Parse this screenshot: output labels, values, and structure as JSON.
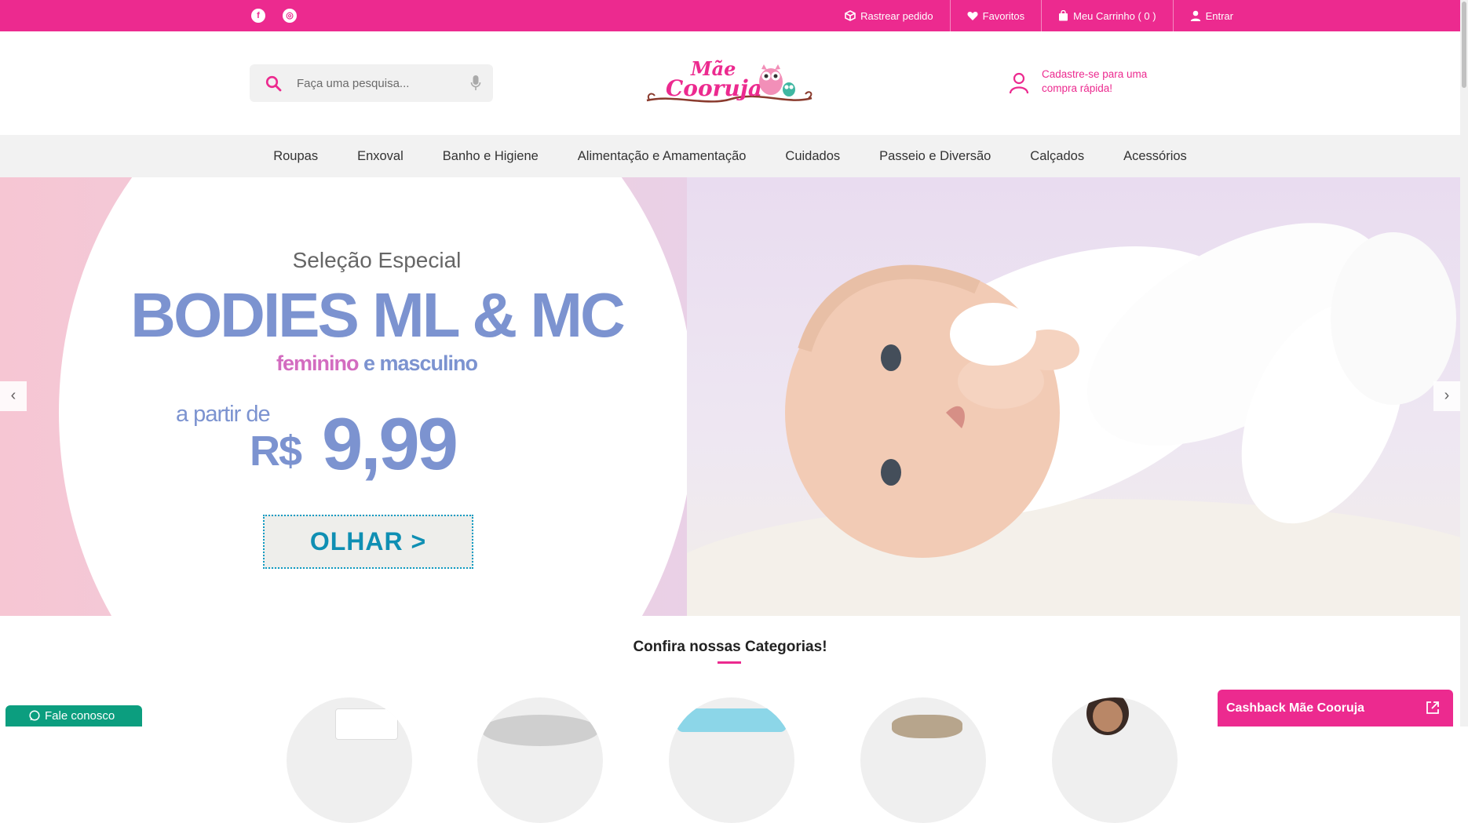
{
  "topbar": {
    "social": [
      {
        "icon": "facebook-icon",
        "glyph": "f"
      },
      {
        "icon": "instagram-icon",
        "glyph": "◎"
      }
    ],
    "links": [
      {
        "label": "Rastrear pedido",
        "icon": "package-icon"
      },
      {
        "label": "Favoritos",
        "icon": "heart-icon"
      },
      {
        "label": "Meu Carrinho ( 0 )",
        "icon": "shopping-bag-icon"
      },
      {
        "label": "Entrar",
        "icon": "user-icon"
      }
    ]
  },
  "header": {
    "search_placeholder": "Faça uma pesquisa...",
    "logo_line1": "Mãe",
    "logo_line2": "Cooruja",
    "register_text": "Cadastre-se para uma compra rápida!"
  },
  "nav": {
    "items": [
      "Roupas",
      "Enxoval",
      "Banho e Higiene",
      "Alimentação e Amamentação",
      "Cuidados",
      "Passeio e Diversão",
      "Calçados",
      "Acessórios"
    ]
  },
  "hero": {
    "subtitle": "Seleção Especial",
    "title": "BODIES ML & MC",
    "tag_feminine": "feminino",
    "tag_rest": " e masculino",
    "from": "a partir de",
    "currency": "R$",
    "price": "9,99",
    "button": "OLHAR >",
    "prev": "‹",
    "next": "›"
  },
  "categories": {
    "title": "Confira nossas Categorias!"
  },
  "widgets": {
    "cashback": "Cashback Mãe Cooruja",
    "chat": "Fale conosco"
  },
  "colors": {
    "brand_pink": "#ec2a8f",
    "hero_blue": "#7c93d0",
    "chat_green": "#0c9e7f"
  }
}
